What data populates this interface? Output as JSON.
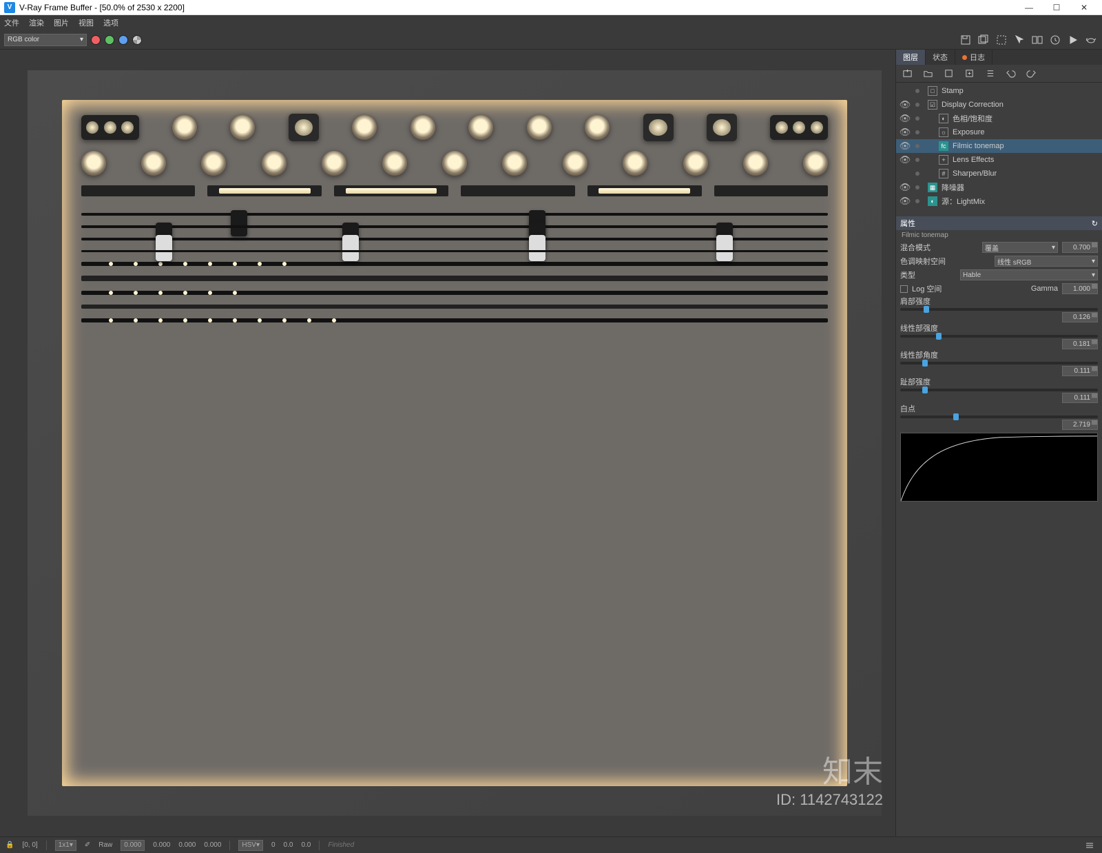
{
  "window": {
    "logo_text": "V",
    "title": "V-Ray Frame Buffer - [50.0% of 2530 x 2200]",
    "min": "—",
    "max": "☐",
    "close": "✕"
  },
  "menu": {
    "file": "文件",
    "render": "渲染",
    "image": "图片",
    "view": "视图",
    "options": "选项"
  },
  "toolbar": {
    "channel_selector": "RGB color"
  },
  "side_tabs": {
    "layers": "图层",
    "state": "状态",
    "log": "日志"
  },
  "layers": [
    {
      "indent": 0,
      "icon": "□",
      "label": "Stamp",
      "enabled": false
    },
    {
      "indent": 0,
      "icon": "☑",
      "label": "Display Correction",
      "enabled": true
    },
    {
      "indent": 1,
      "icon": "◐",
      "label": "色相/饱和度",
      "enabled": true
    },
    {
      "indent": 1,
      "icon": "☼",
      "label": "Exposure",
      "enabled": true
    },
    {
      "indent": 1,
      "icon": "fc",
      "label": "Filmic tonemap",
      "enabled": true,
      "active": true,
      "teal": true
    },
    {
      "indent": 1,
      "icon": "+",
      "label": "Lens Effects",
      "enabled": true
    },
    {
      "indent": 1,
      "icon": "#",
      "label": "Sharpen/Blur",
      "enabled": false
    },
    {
      "indent": 0,
      "icon": "▦",
      "label": "降噪器",
      "enabled": true,
      "teal": true
    },
    {
      "indent": 0,
      "icon": "◐",
      "label": "源：LightMix",
      "enabled": true,
      "teal": true
    }
  ],
  "props": {
    "header": "属性",
    "subtitle": "Filmic tonemap",
    "refresh_icon": "↻",
    "blend_label": "混合模式",
    "blend_value": "覆盖",
    "blend_amount": "0.700",
    "colorspace_label": "色调映射空间",
    "colorspace_value": "线性 sRGB",
    "type_label": "类型",
    "type_value": "Hable",
    "log_label": "Log 空间",
    "gamma_label": "Gamma",
    "gamma_value": "1.000",
    "shoulder_label": "肩部强度",
    "shoulder_value": "0.126",
    "linear_strength_label": "线性部强度",
    "linear_strength_value": "0.181",
    "linear_angle_label": "线性部角度",
    "linear_angle_value": "0.111",
    "toe_label": "趾部强度",
    "toe_value": "0.111",
    "white_label": "白点",
    "white_value": "2.719"
  },
  "sliders": {
    "shoulder_pct": 12,
    "linear_strength_pct": 18,
    "linear_angle_pct": 11,
    "toe_pct": 11,
    "white_pct": 27
  },
  "status": {
    "lock": "🔒",
    "coords": "[0, 0]",
    "zoom": "1x1",
    "raw_label": "Raw",
    "r": "0.000",
    "g": "0.000",
    "b": "0.000",
    "a": "0.000",
    "hsv_label": "HSV",
    "h": "0",
    "s": "0.0",
    "v": "0.0",
    "status_text": "Finished"
  },
  "watermark": {
    "brand": "知末",
    "id": "ID: 1142743122"
  }
}
